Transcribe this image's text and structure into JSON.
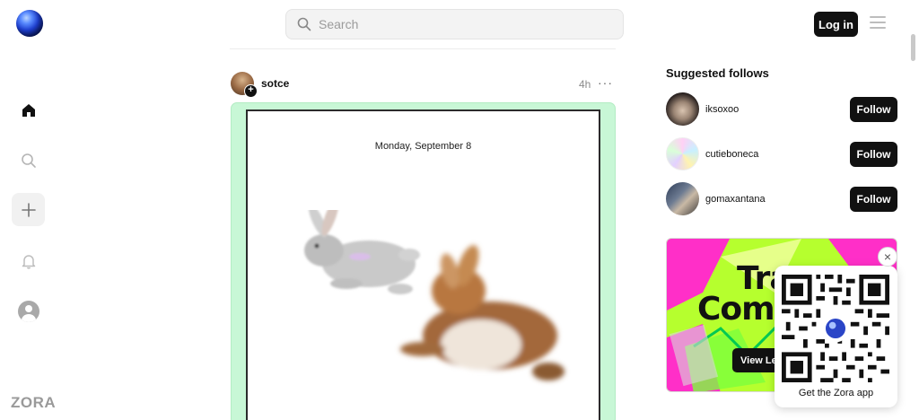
{
  "header": {
    "search": {
      "placeholder": "Search"
    },
    "login_label": "Log in"
  },
  "sidebar": {
    "items": [
      {
        "icon": "home-icon"
      },
      {
        "icon": "search-icon"
      },
      {
        "icon": "plus-icon"
      },
      {
        "icon": "bell-icon"
      },
      {
        "icon": "profile-icon"
      }
    ],
    "wordmark": "ZORA"
  },
  "post": {
    "username": "sotce",
    "time": "4h",
    "more": "···",
    "date": "Monday, September 8"
  },
  "suggested": {
    "title": "Suggested follows",
    "users": [
      {
        "name": "iksoxoo",
        "follow_label": "Follow"
      },
      {
        "name": "cutieboneca",
        "follow_label": "Follow"
      },
      {
        "name": "gomaxantana",
        "follow_label": "Follow"
      }
    ]
  },
  "promo": {
    "line1": "Tra",
    "line2": "Comp",
    "button_label": "View Le"
  },
  "app_card": {
    "caption": "Get the Zora app",
    "close": "×"
  },
  "colors": {
    "post_frame": "#c8f7d6",
    "promo_pink": "#ff2fc8",
    "promo_green": "#b6ff2e",
    "button": "#111111"
  }
}
